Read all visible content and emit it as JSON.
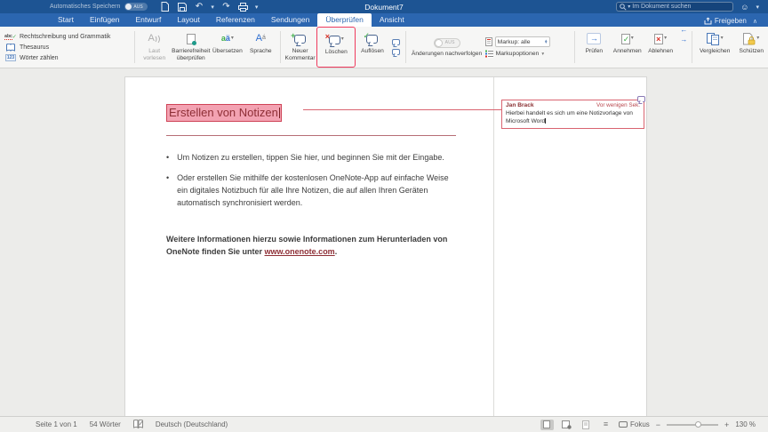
{
  "titlebar": {
    "autosave_label": "Automatisches Speichern",
    "autosave_state": "AUS",
    "document_title": "Dokument7",
    "search_placeholder": "Im Dokument suchen"
  },
  "tabs": {
    "items": [
      "Start",
      "Einfügen",
      "Entwurf",
      "Layout",
      "Referenzen",
      "Sendungen",
      "Überprüfen",
      "Ansicht"
    ],
    "active": "Überprüfen",
    "share_label": "Freigeben"
  },
  "ribbon": {
    "spelling_grammar": "Rechtschreibung und Grammatik",
    "thesaurus": "Thesaurus",
    "word_count": "Wörter zählen",
    "read_aloud": "Laut vorlesen",
    "accessibility": "Barrierefreiheit überprüfen",
    "translate": "Übersetzen",
    "language": "Sprache",
    "new_comment": "Neuer Kommentar",
    "delete_comment": "Löschen",
    "resolve": "Auflösen",
    "track_changes_label": "Änderungen nachverfolgen",
    "track_changes_state": "AUS",
    "markup_value": "Markup: alle",
    "markup_options": "Markupoptionen",
    "check": "Prüfen",
    "accept": "Annehmen",
    "reject": "Ablehnen",
    "compare": "Vergleichen",
    "protect": "Schützen"
  },
  "document": {
    "heading": "Erstellen von Notizen",
    "bullets": [
      "Um Notizen zu erstellen, tippen Sie hier, und beginnen Sie mit der Eingabe.",
      "Oder erstellen Sie mithilfe der kostenlosen OneNote-App auf einfache Weise ein digitales Notizbuch für alle Ihre Notizen, die auf allen Ihren Geräten automatisch synchronisiert werden."
    ],
    "footer_text_1": "Weitere Informationen hierzu sowie Informationen zum Herunterladen von OneNote finden Sie unter ",
    "footer_link": "www.onenote.com",
    "footer_text_2": "."
  },
  "comment": {
    "author": "Jan Brack",
    "time": "Vor wenigen Sek.",
    "text": "Hierbei handelt es sich um eine Notizvorlage von Microsoft Word"
  },
  "statusbar": {
    "page_count": "Seite 1 von 1",
    "word_count": "54 Wörter",
    "language": "Deutsch (Deutschland)",
    "focus_label": "Fokus",
    "zoom_level": "130 %",
    "minus": "−",
    "plus": "+"
  },
  "icons": {
    "caret_down": "▾",
    "chevron_up": "∧",
    "undo": "↶",
    "redo": "↷",
    "smiley": "☺",
    "plus": "+",
    "cross": "×",
    "check": "✓",
    "arrow_left": "←",
    "arrow_right": "→",
    "lines": "≡",
    "abc": "abc",
    "numbers": "123",
    "letter_a": "A"
  },
  "colors": {
    "titlebar_blue": "#1d5493",
    "tabrow_blue": "#2b66b0",
    "annotation_red": "#ef3a5d",
    "comment_red": "#d96470",
    "heading_maroon": "#8e2f36",
    "highlight_pink": "#f3a2b2"
  }
}
